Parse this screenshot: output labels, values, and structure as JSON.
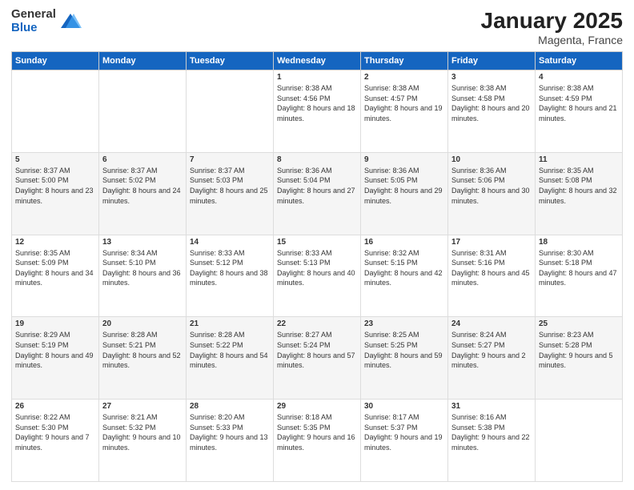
{
  "logo": {
    "general": "General",
    "blue": "Blue"
  },
  "header": {
    "month": "January 2025",
    "location": "Magenta, France"
  },
  "weekdays": [
    "Sunday",
    "Monday",
    "Tuesday",
    "Wednesday",
    "Thursday",
    "Friday",
    "Saturday"
  ],
  "weeks": [
    [
      {
        "day": "",
        "sunrise": "",
        "sunset": "",
        "daylight": ""
      },
      {
        "day": "",
        "sunrise": "",
        "sunset": "",
        "daylight": ""
      },
      {
        "day": "",
        "sunrise": "",
        "sunset": "",
        "daylight": ""
      },
      {
        "day": "1",
        "sunrise": "Sunrise: 8:38 AM",
        "sunset": "Sunset: 4:56 PM",
        "daylight": "Daylight: 8 hours and 18 minutes."
      },
      {
        "day": "2",
        "sunrise": "Sunrise: 8:38 AM",
        "sunset": "Sunset: 4:57 PM",
        "daylight": "Daylight: 8 hours and 19 minutes."
      },
      {
        "day": "3",
        "sunrise": "Sunrise: 8:38 AM",
        "sunset": "Sunset: 4:58 PM",
        "daylight": "Daylight: 8 hours and 20 minutes."
      },
      {
        "day": "4",
        "sunrise": "Sunrise: 8:38 AM",
        "sunset": "Sunset: 4:59 PM",
        "daylight": "Daylight: 8 hours and 21 minutes."
      }
    ],
    [
      {
        "day": "5",
        "sunrise": "Sunrise: 8:37 AM",
        "sunset": "Sunset: 5:00 PM",
        "daylight": "Daylight: 8 hours and 23 minutes."
      },
      {
        "day": "6",
        "sunrise": "Sunrise: 8:37 AM",
        "sunset": "Sunset: 5:02 PM",
        "daylight": "Daylight: 8 hours and 24 minutes."
      },
      {
        "day": "7",
        "sunrise": "Sunrise: 8:37 AM",
        "sunset": "Sunset: 5:03 PM",
        "daylight": "Daylight: 8 hours and 25 minutes."
      },
      {
        "day": "8",
        "sunrise": "Sunrise: 8:36 AM",
        "sunset": "Sunset: 5:04 PM",
        "daylight": "Daylight: 8 hours and 27 minutes."
      },
      {
        "day": "9",
        "sunrise": "Sunrise: 8:36 AM",
        "sunset": "Sunset: 5:05 PM",
        "daylight": "Daylight: 8 hours and 29 minutes."
      },
      {
        "day": "10",
        "sunrise": "Sunrise: 8:36 AM",
        "sunset": "Sunset: 5:06 PM",
        "daylight": "Daylight: 8 hours and 30 minutes."
      },
      {
        "day": "11",
        "sunrise": "Sunrise: 8:35 AM",
        "sunset": "Sunset: 5:08 PM",
        "daylight": "Daylight: 8 hours and 32 minutes."
      }
    ],
    [
      {
        "day": "12",
        "sunrise": "Sunrise: 8:35 AM",
        "sunset": "Sunset: 5:09 PM",
        "daylight": "Daylight: 8 hours and 34 minutes."
      },
      {
        "day": "13",
        "sunrise": "Sunrise: 8:34 AM",
        "sunset": "Sunset: 5:10 PM",
        "daylight": "Daylight: 8 hours and 36 minutes."
      },
      {
        "day": "14",
        "sunrise": "Sunrise: 8:33 AM",
        "sunset": "Sunset: 5:12 PM",
        "daylight": "Daylight: 8 hours and 38 minutes."
      },
      {
        "day": "15",
        "sunrise": "Sunrise: 8:33 AM",
        "sunset": "Sunset: 5:13 PM",
        "daylight": "Daylight: 8 hours and 40 minutes."
      },
      {
        "day": "16",
        "sunrise": "Sunrise: 8:32 AM",
        "sunset": "Sunset: 5:15 PM",
        "daylight": "Daylight: 8 hours and 42 minutes."
      },
      {
        "day": "17",
        "sunrise": "Sunrise: 8:31 AM",
        "sunset": "Sunset: 5:16 PM",
        "daylight": "Daylight: 8 hours and 45 minutes."
      },
      {
        "day": "18",
        "sunrise": "Sunrise: 8:30 AM",
        "sunset": "Sunset: 5:18 PM",
        "daylight": "Daylight: 8 hours and 47 minutes."
      }
    ],
    [
      {
        "day": "19",
        "sunrise": "Sunrise: 8:29 AM",
        "sunset": "Sunset: 5:19 PM",
        "daylight": "Daylight: 8 hours and 49 minutes."
      },
      {
        "day": "20",
        "sunrise": "Sunrise: 8:28 AM",
        "sunset": "Sunset: 5:21 PM",
        "daylight": "Daylight: 8 hours and 52 minutes."
      },
      {
        "day": "21",
        "sunrise": "Sunrise: 8:28 AM",
        "sunset": "Sunset: 5:22 PM",
        "daylight": "Daylight: 8 hours and 54 minutes."
      },
      {
        "day": "22",
        "sunrise": "Sunrise: 8:27 AM",
        "sunset": "Sunset: 5:24 PM",
        "daylight": "Daylight: 8 hours and 57 minutes."
      },
      {
        "day": "23",
        "sunrise": "Sunrise: 8:25 AM",
        "sunset": "Sunset: 5:25 PM",
        "daylight": "Daylight: 8 hours and 59 minutes."
      },
      {
        "day": "24",
        "sunrise": "Sunrise: 8:24 AM",
        "sunset": "Sunset: 5:27 PM",
        "daylight": "Daylight: 9 hours and 2 minutes."
      },
      {
        "day": "25",
        "sunrise": "Sunrise: 8:23 AM",
        "sunset": "Sunset: 5:28 PM",
        "daylight": "Daylight: 9 hours and 5 minutes."
      }
    ],
    [
      {
        "day": "26",
        "sunrise": "Sunrise: 8:22 AM",
        "sunset": "Sunset: 5:30 PM",
        "daylight": "Daylight: 9 hours and 7 minutes."
      },
      {
        "day": "27",
        "sunrise": "Sunrise: 8:21 AM",
        "sunset": "Sunset: 5:32 PM",
        "daylight": "Daylight: 9 hours and 10 minutes."
      },
      {
        "day": "28",
        "sunrise": "Sunrise: 8:20 AM",
        "sunset": "Sunset: 5:33 PM",
        "daylight": "Daylight: 9 hours and 13 minutes."
      },
      {
        "day": "29",
        "sunrise": "Sunrise: 8:18 AM",
        "sunset": "Sunset: 5:35 PM",
        "daylight": "Daylight: 9 hours and 16 minutes."
      },
      {
        "day": "30",
        "sunrise": "Sunrise: 8:17 AM",
        "sunset": "Sunset: 5:37 PM",
        "daylight": "Daylight: 9 hours and 19 minutes."
      },
      {
        "day": "31",
        "sunrise": "Sunrise: 8:16 AM",
        "sunset": "Sunset: 5:38 PM",
        "daylight": "Daylight: 9 hours and 22 minutes."
      },
      {
        "day": "",
        "sunrise": "",
        "sunset": "",
        "daylight": ""
      }
    ]
  ]
}
